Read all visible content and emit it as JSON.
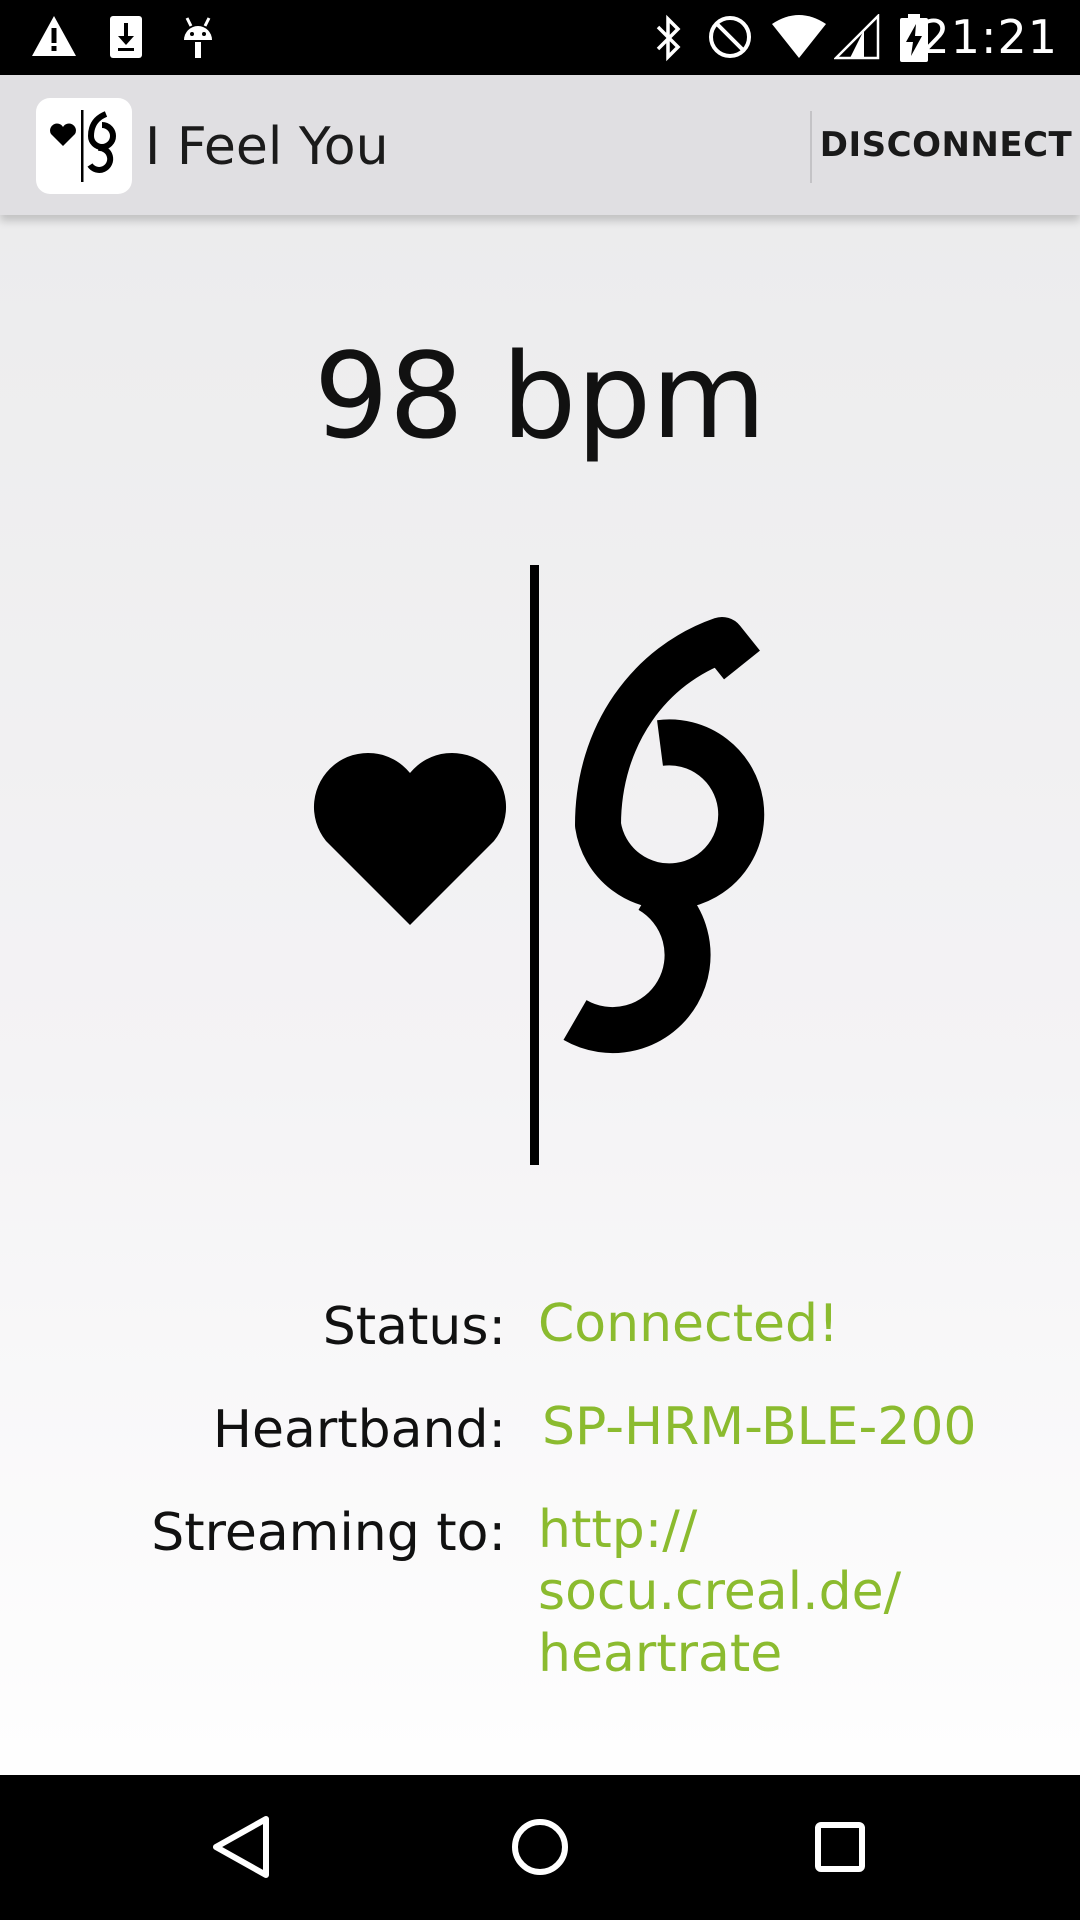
{
  "status_bar": {
    "time": "21:21",
    "left_icons": [
      "warning-icon",
      "download-icon",
      "android-debug-icon"
    ],
    "right_icons": [
      "bluetooth-icon",
      "do-not-disturb-icon",
      "wifi-icon",
      "signal-icon",
      "battery-charging-icon"
    ]
  },
  "app_bar": {
    "title": "I Feel You",
    "action_label": "DISCONNECT"
  },
  "main": {
    "heart_rate": "98 bpm",
    "status_label": "Status:",
    "status_value": "Connected!",
    "heartband_label": "Heartband:",
    "heartband_value": "SP-HRM-BLE-200",
    "streaming_label": "Streaming to:",
    "streaming_value_lines": [
      "http://",
      "socu.creal.de/",
      "heartrate"
    ]
  },
  "colors": {
    "accent_green": "#8bbb2f",
    "app_bar_bg": "#e0dfe2"
  },
  "nav_bar": {
    "icons": [
      "back-icon",
      "home-icon",
      "recents-icon"
    ]
  }
}
